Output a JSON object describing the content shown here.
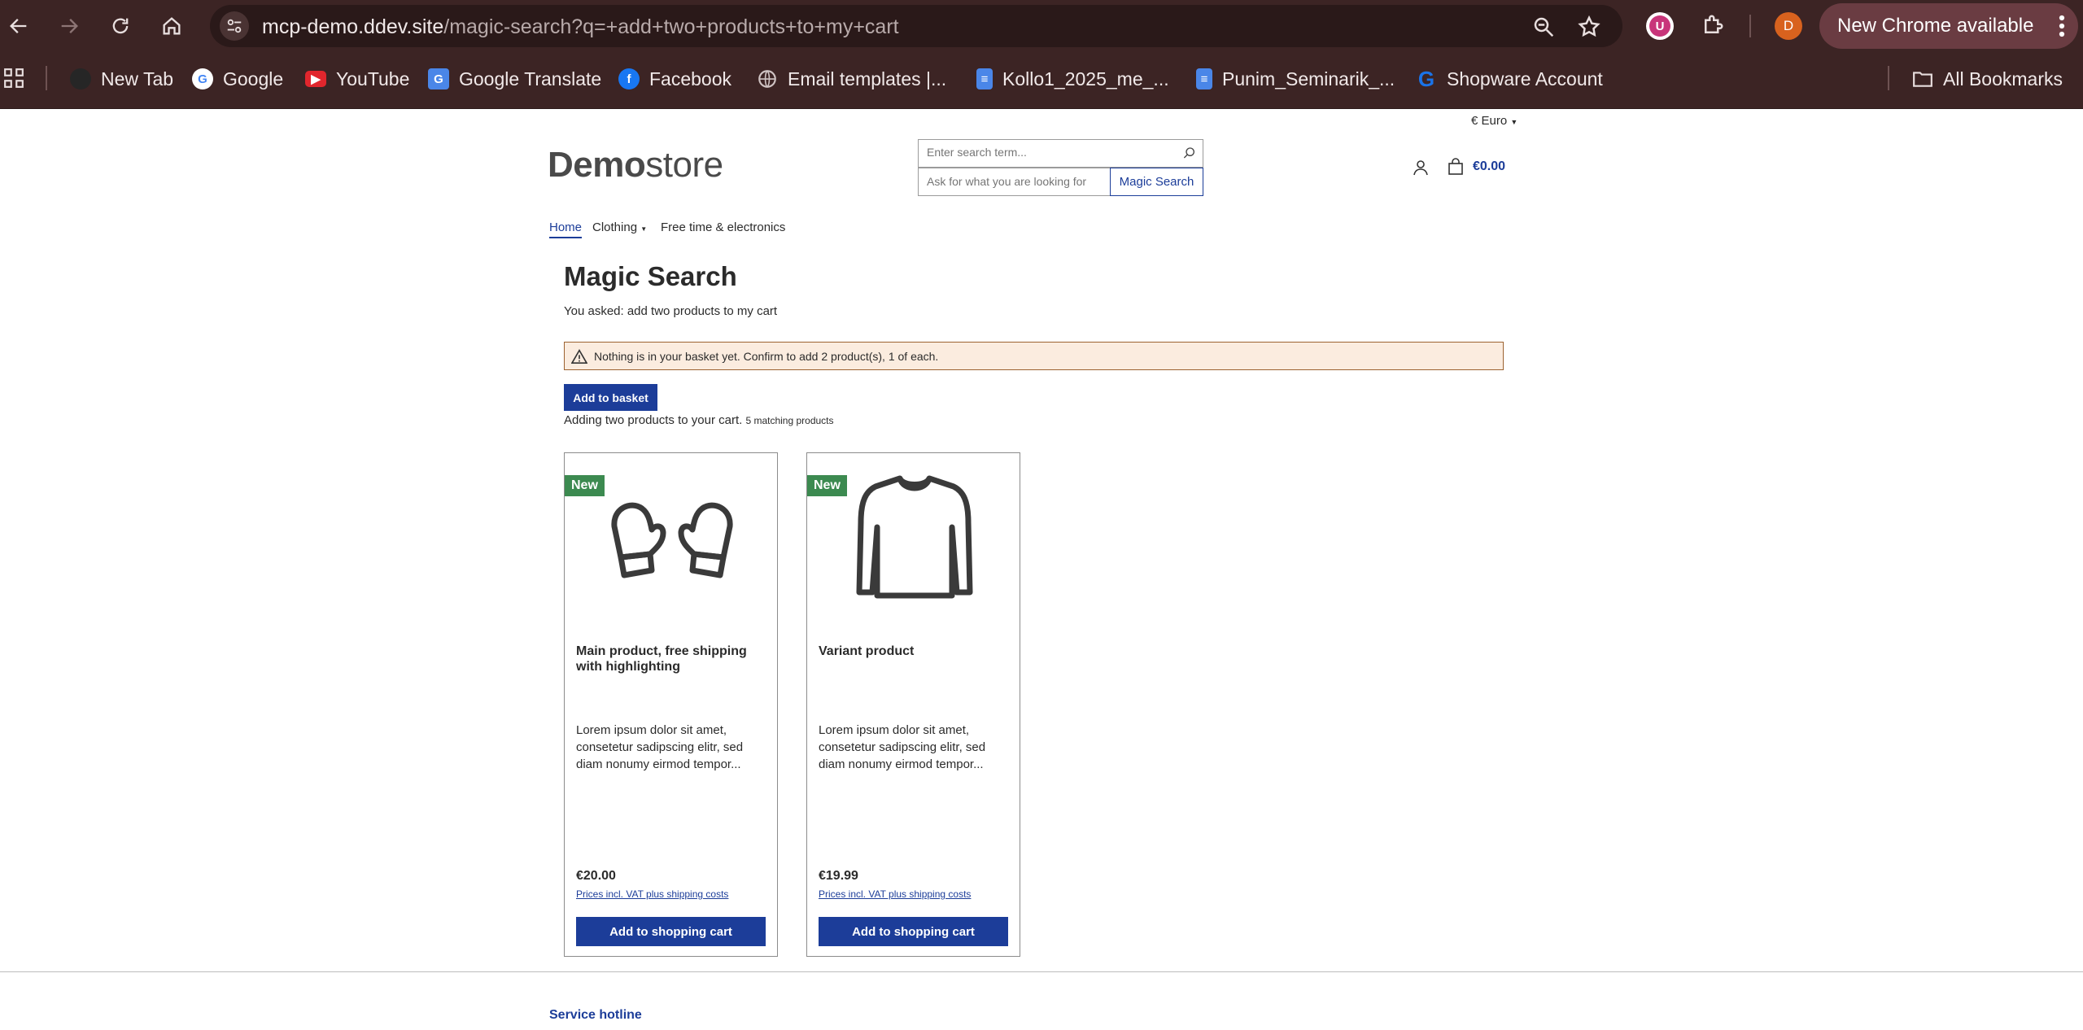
{
  "browser": {
    "url_host": "mcp-demo.ddev.site",
    "url_path": "/magic-search?q=+add+two+products+to+my+cart",
    "profile_initial": "D",
    "extension_initial": "U",
    "update_label": "New Chrome available",
    "bookmarks": [
      {
        "label": "New Tab",
        "icon": "new-tab-icon"
      },
      {
        "label": "Google",
        "icon": "google-icon"
      },
      {
        "label": "YouTube",
        "icon": "youtube-icon"
      },
      {
        "label": "Google Translate",
        "icon": "translate-icon"
      },
      {
        "label": "Facebook",
        "icon": "facebook-icon"
      },
      {
        "label": "Email templates |...",
        "icon": "globe-icon"
      },
      {
        "label": "Kollo1_2025_me_...",
        "icon": "doc-icon"
      },
      {
        "label": "Punim_Seminarik_...",
        "icon": "doc-icon"
      },
      {
        "label": "Shopware Account",
        "icon": "shopware-icon"
      }
    ],
    "all_bookmarks": "All Bookmarks"
  },
  "header": {
    "currency": "€ Euro",
    "logo_bold": "Demo",
    "logo_light": "store",
    "search_placeholder": "Enter search term...",
    "magic_placeholder": "Ask for what you are looking for",
    "magic_button": "Magic Search",
    "cart_total": "€0.00"
  },
  "nav": {
    "items": [
      "Home",
      "Clothing",
      "Free time & electronics"
    ]
  },
  "main": {
    "title": "Magic Search",
    "asked": "You asked: add two products to my cart",
    "alert": "Nothing is in your basket yet. Confirm to add 2 product(s), 1 of each.",
    "add_basket": "Add to basket",
    "adding": "Adding two products to your cart.",
    "matching": "5 matching products"
  },
  "products": [
    {
      "badge": "New",
      "title": "Main product, free shipping with highlighting",
      "desc": "Lorem ipsum dolor sit amet, consetetur sadipscing elitr, sed diam nonumy eirmod tempor...",
      "price": "€20.00",
      "vat": "Prices incl. VAT plus shipping costs",
      "button": "Add to shopping cart",
      "image": "mittens-icon"
    },
    {
      "badge": "New",
      "title": "Variant product",
      "desc": "Lorem ipsum dolor sit amet, consetetur sadipscing elitr, sed diam nonumy eirmod tempor...",
      "price": "€19.99",
      "vat": "Prices incl. VAT plus shipping costs",
      "button": "Add to shopping cart",
      "image": "longsleeve-shirt-icon"
    }
  ],
  "footer": {
    "hotline": "Service hotline"
  },
  "colors": {
    "brand": "#1c3d99",
    "badge": "#3c8a50",
    "alert_bg": "#fbecdf",
    "chrome_bg": "#3c2424"
  }
}
